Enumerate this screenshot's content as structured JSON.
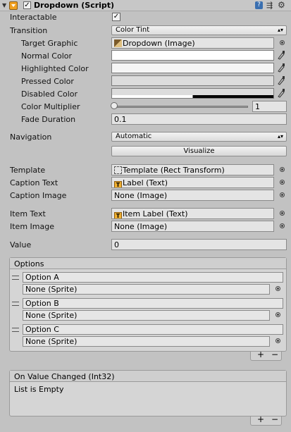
{
  "header": {
    "title": "Dropdown (Script)",
    "enabled": true
  },
  "interactable": {
    "label": "Interactable",
    "checked": true
  },
  "transition": {
    "label": "Transition",
    "value": "Color Tint"
  },
  "target_graphic": {
    "label": "Target Graphic",
    "value": "Dropdown (Image)"
  },
  "colors": {
    "normal": {
      "label": "Normal Color",
      "value": "#FFFFFF"
    },
    "highlighted": {
      "label": "Highlighted Color",
      "value": "#F5F5F5"
    },
    "pressed": {
      "label": "Pressed Color",
      "value": "#C8C8C8"
    },
    "disabled": {
      "label": "Disabled Color",
      "value": "#C8C8C8"
    }
  },
  "color_multiplier": {
    "label": "Color Multiplier",
    "value": "1",
    "slider": 0.0
  },
  "fade_duration": {
    "label": "Fade Duration",
    "value": "0.1"
  },
  "navigation": {
    "label": "Navigation",
    "value": "Automatic",
    "visualize": "Visualize"
  },
  "template": {
    "label": "Template",
    "value": "Template (Rect Transform)"
  },
  "caption_text": {
    "label": "Caption Text",
    "value": "Label (Text)"
  },
  "caption_image": {
    "label": "Caption Image",
    "value": "None (Image)"
  },
  "item_text": {
    "label": "Item Text",
    "value": "Item Label (Text)"
  },
  "item_image": {
    "label": "Item Image",
    "value": "None (Image)"
  },
  "value": {
    "label": "Value",
    "value": "0"
  },
  "options": {
    "title": "Options",
    "items": [
      {
        "text": "Option A",
        "image": "None (Sprite)"
      },
      {
        "text": "Option B",
        "image": "None (Sprite)"
      },
      {
        "text": "Option C",
        "image": "None (Sprite)"
      }
    ],
    "add": "+",
    "remove": "−"
  },
  "on_value_changed": {
    "title": "On Value Changed (Int32)",
    "empty": "List is Empty",
    "add": "+",
    "remove": "−"
  }
}
